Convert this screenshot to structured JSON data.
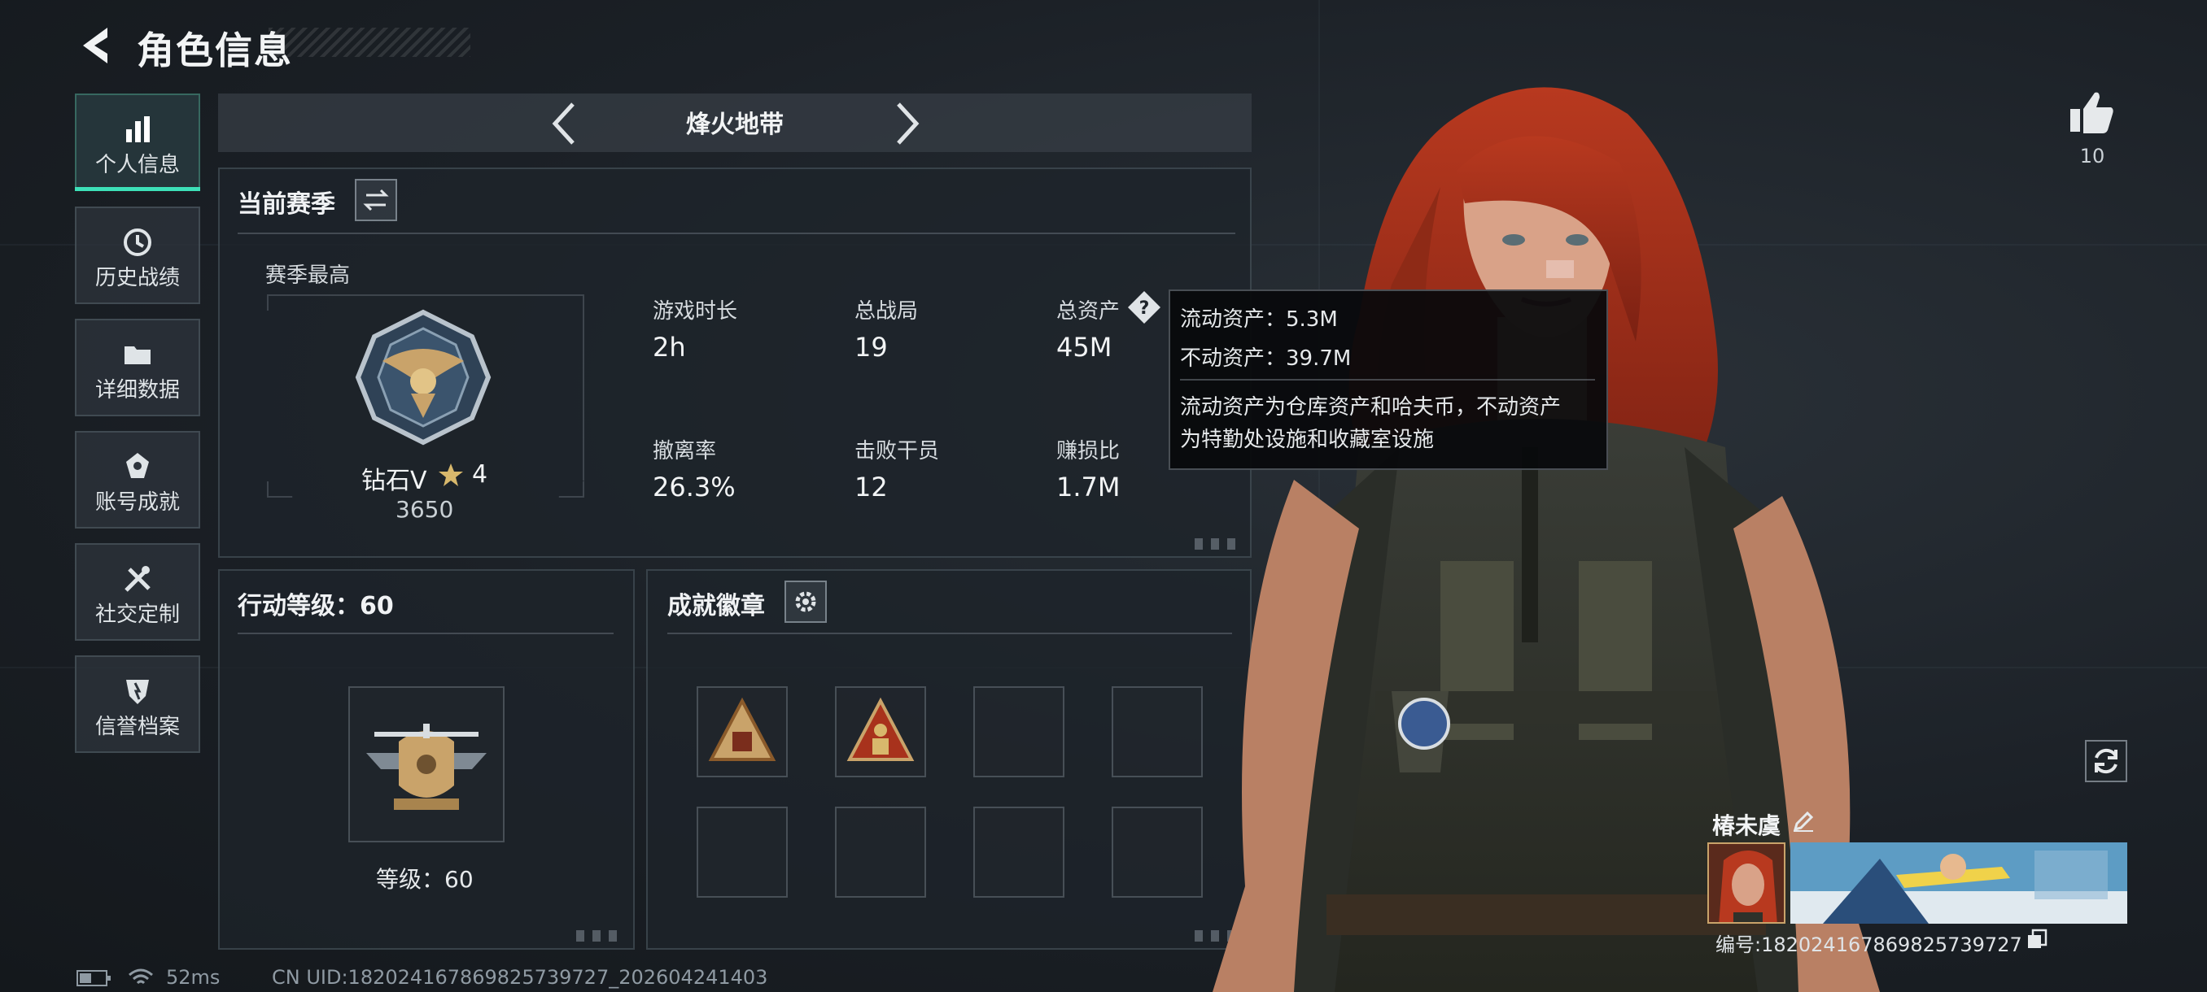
{
  "header": {
    "title": "角色信息"
  },
  "sidebar": {
    "items": [
      {
        "label": "个人信息",
        "icon": "bar-chart-icon",
        "active": true
      },
      {
        "label": "历史战绩",
        "icon": "history-icon"
      },
      {
        "label": "详细数据",
        "icon": "folder-icon"
      },
      {
        "label": "账号成就",
        "icon": "achievement-icon"
      },
      {
        "label": "社交定制",
        "icon": "tools-icon"
      },
      {
        "label": "信誉档案",
        "icon": "shield-icon"
      }
    ]
  },
  "mode": {
    "title": "烽火地带"
  },
  "season": {
    "heading": "当前赛季",
    "best_label": "赛季最高",
    "rank_name": "钻石V",
    "rank_stars": "4",
    "rank_points": "3650",
    "stats": [
      {
        "label": "游戏时长",
        "value": "2h"
      },
      {
        "label": "总战局",
        "value": "19"
      },
      {
        "label": "总资产",
        "value": "45M"
      },
      {
        "label": "撤离率",
        "value": "26.3%"
      },
      {
        "label": "击败干员",
        "value": "12"
      },
      {
        "label": "赚损比",
        "value": "1.7M"
      }
    ]
  },
  "tooltip": {
    "liquid": "流动资产：5.3M",
    "fixed": "不动资产：39.7M",
    "desc_line1": "流动资产为仓库资产和哈夫币，不动资产",
    "desc_line2": "为特勤处设施和收藏室设施"
  },
  "action_level": {
    "heading": "行动等级：60",
    "level_label": "等级：60"
  },
  "badges": {
    "heading": "成就徽章",
    "slots_filled": 2,
    "slots_total": 8
  },
  "profile": {
    "likes": "10",
    "nickname": "椿未虞",
    "id_text": "编号:18202416786982573972​7"
  },
  "status_bar": {
    "ping": "52ms",
    "uid": "CN UID:18202416786982573972​7_202604241403"
  },
  "colors": {
    "accent": "#3de0b8",
    "hair": "#a8321c",
    "gold": "#c9a36a"
  }
}
